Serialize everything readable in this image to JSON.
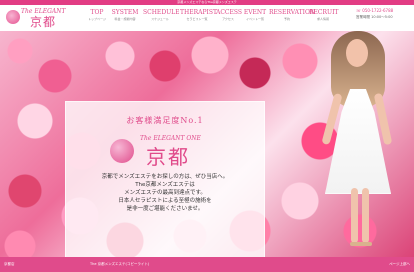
{
  "topbar": {
    "text": "京都メンズエステならThe京都メンズエステ"
  },
  "header": {
    "logo": {
      "script_text": "The ELEGANT",
      "kanji": "京都"
    },
    "nav": [
      {
        "en": "TOP",
        "jp": "トップページ"
      },
      {
        "en": "SYSTEM",
        "jp": "料金・施術内容"
      },
      {
        "en": "SCHEDULE",
        "jp": "スケジュール"
      },
      {
        "en": "THERAPIST",
        "jp": "セラピスト一覧"
      },
      {
        "en": "ACCESS",
        "jp": "アクセス"
      },
      {
        "en": "EVENT",
        "jp": "イベント一覧"
      },
      {
        "en": "RESERVATION",
        "jp": "予約"
      },
      {
        "en": "RECRUIT",
        "jp": "求人情報"
      }
    ],
    "contact": {
      "phone": "☏ 050-1722-6788",
      "hours_label": "営業時間",
      "hours": "10:00〜5:00"
    }
  },
  "panel": {
    "title": "お客様満足度No.1",
    "logo": {
      "script_text": "The ELEGANT ONE",
      "kanji": "京都"
    },
    "lines": [
      "京都でメンズエステをお探しの方は、ぜひ当店へ。",
      "The京都メンズエステは",
      "メンズエステの最高到達点です。",
      "日本人セラピストによる至極の施術を",
      "是非一度ご堪能くださいませ。"
    ]
  },
  "footer": {
    "left": "京都店",
    "center": "The 京都メンズエステ(コピーライト)",
    "right": "ページ上部へ"
  },
  "colors": {
    "brand_pink": "#e04b8b",
    "panel_bg": "#ffffff",
    "text_dark": "#333333"
  }
}
